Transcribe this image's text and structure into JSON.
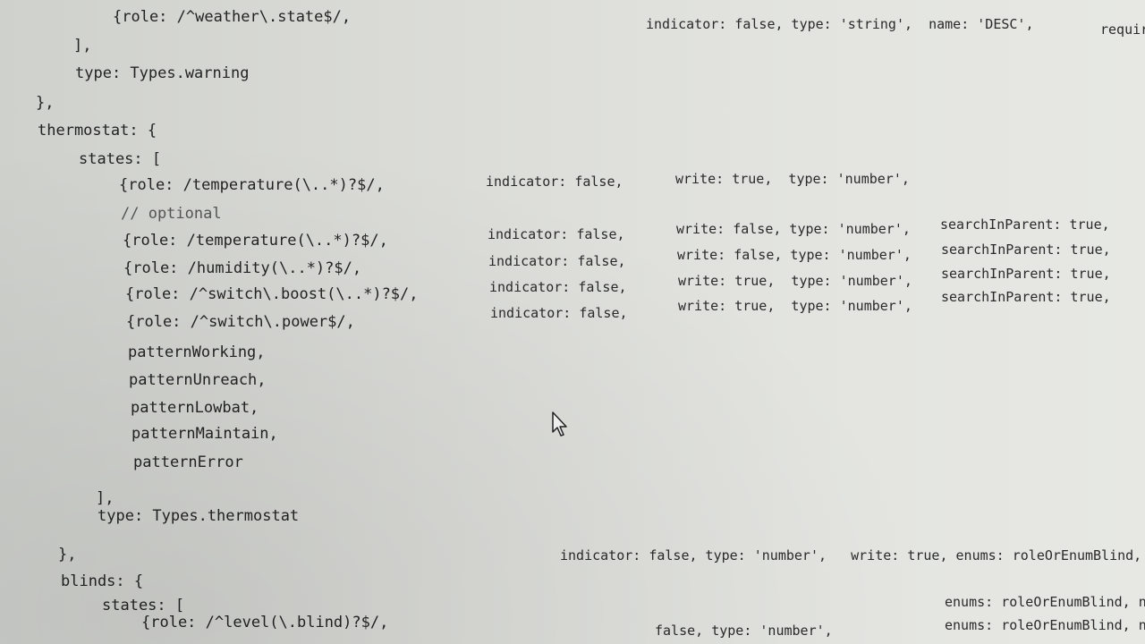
{
  "code_lines": [
    {
      "text": "{role: /^weather\\.state$/,"
    },
    {
      "text": "],"
    },
    {
      "text": "type: Types.warning"
    },
    {
      "text": "},"
    },
    {
      "text": "thermostat: {"
    },
    {
      "text": "states: ["
    },
    {
      "text": "{role: /temperature(\\..*)?$/,"
    },
    {
      "text": "// optional"
    },
    {
      "text": "{role: /temperature(\\..*)?$/,"
    },
    {
      "text": "{role: /humidity(\\..*)?$/,"
    },
    {
      "text": "{role: /^switch\\.boost(\\..*)?$/,"
    },
    {
      "text": "{role: /^switch\\.power$/,"
    },
    {
      "text": "patternWorking,"
    },
    {
      "text": "patternUnreach,"
    },
    {
      "text": "patternLowbat,"
    },
    {
      "text": "patternMaintain,"
    },
    {
      "text": "patternError"
    },
    {
      "text": "],"
    },
    {
      "text": "type: Types.thermostat"
    },
    {
      "text": "},"
    },
    {
      "text": "blinds: {"
    },
    {
      "text": "states: ["
    },
    {
      "text": "{role: /^level(\\.blind)?$/,"
    }
  ],
  "fragments": [
    {
      "text": "indicator: false, type: 'string',  name: 'DESC',"
    },
    {
      "text": "requir"
    },
    {
      "text": "indicator: false,"
    },
    {
      "text": "write: true,  type: 'number',"
    },
    {
      "text": "indicator: false,"
    },
    {
      "text": "write: false, type: 'number',"
    },
    {
      "text": "searchInParent: true,"
    },
    {
      "text": "indicator: false,"
    },
    {
      "text": "write: false, type: 'number',"
    },
    {
      "text": "searchInParent: true,"
    },
    {
      "text": "indicator: false,"
    },
    {
      "text": "write: true,  type: 'number',"
    },
    {
      "text": "searchInParent: true,"
    },
    {
      "text": "indicator: false,"
    },
    {
      "text": "write: true,  type: 'number',"
    },
    {
      "text": "searchInParent: true,"
    },
    {
      "text": "indicator: false, type: 'number',   write: true, enums: roleOrEnumBlind, name"
    },
    {
      "text": "enums: roleOrEnumBlind, name"
    },
    {
      "text": "false, type: 'number',"
    },
    {
      "text": "enums: roleOrEnumBlind, name"
    }
  ]
}
